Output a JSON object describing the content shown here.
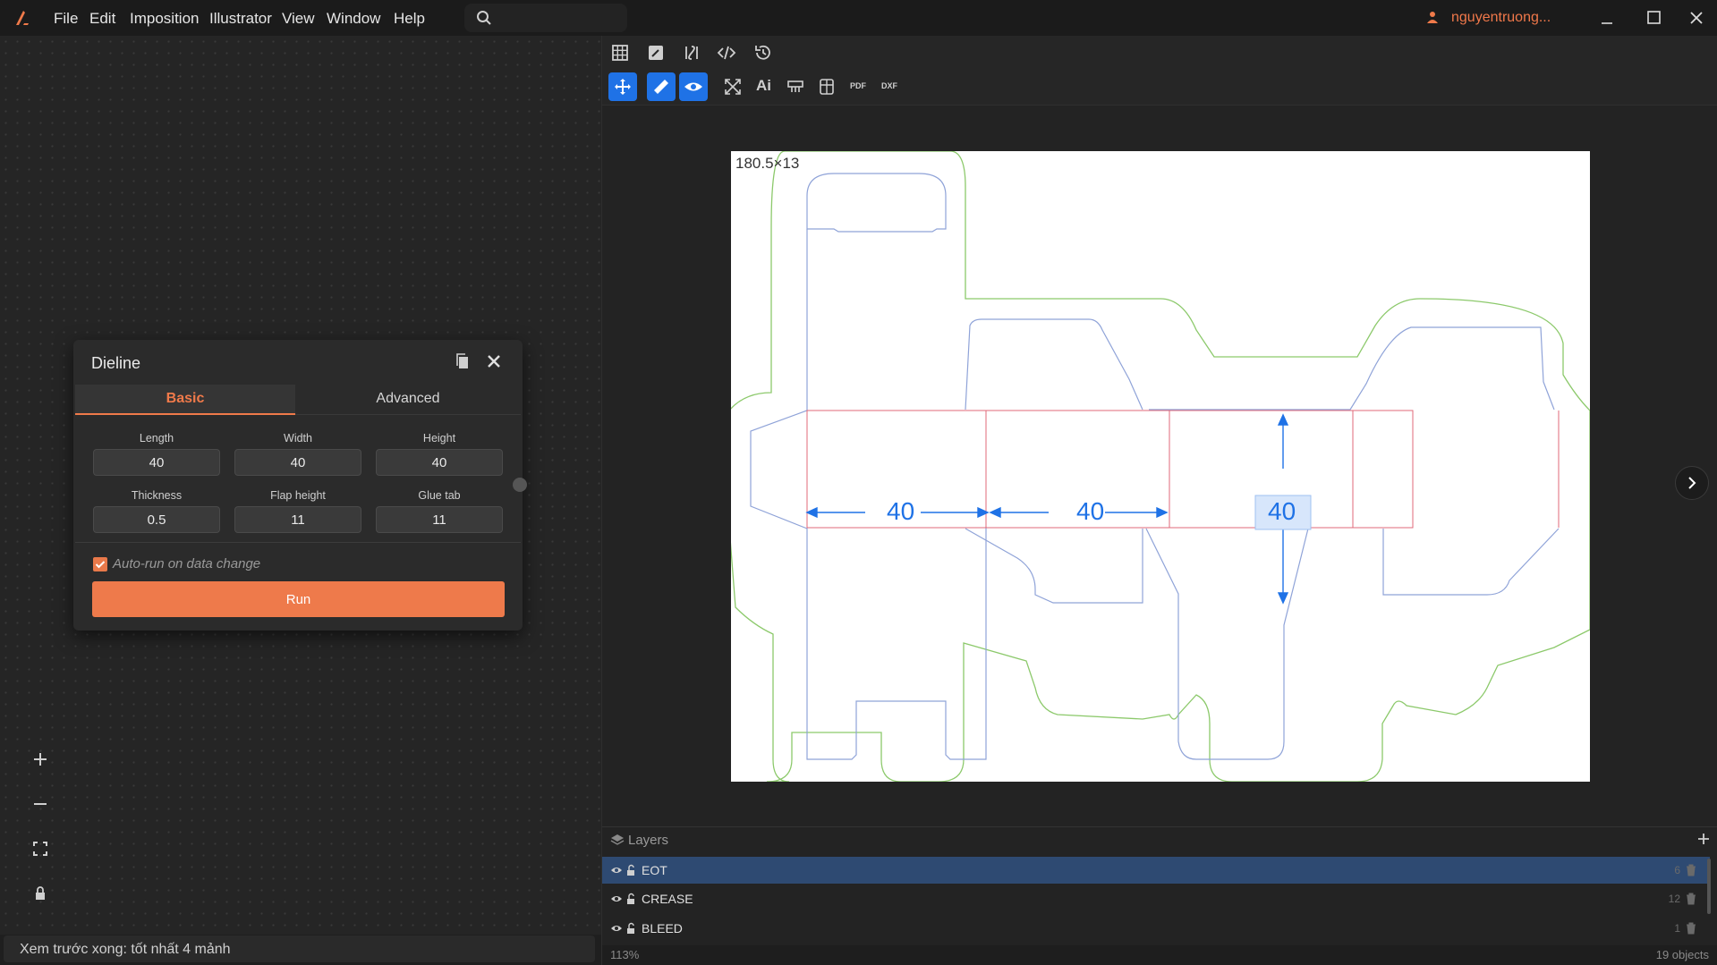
{
  "menu": [
    "File",
    "Edit",
    "Imposition",
    "Illustrator",
    "View",
    "Window",
    "Help"
  ],
  "user": {
    "name": "nguyentruong..."
  },
  "status_text": "Xem trước xong: tốt nhất 4 mảnh",
  "dialog": {
    "title": "Dieline",
    "tabs": [
      "Basic",
      "Advanced"
    ],
    "fields": [
      {
        "label": "Length",
        "value": "40"
      },
      {
        "label": "Width",
        "value": "40"
      },
      {
        "label": "Height",
        "value": "40"
      },
      {
        "label": "Thickness",
        "value": "0.5"
      },
      {
        "label": "Flap height",
        "value": "11"
      },
      {
        "label": "Glue tab",
        "value": "11"
      }
    ],
    "auto_run_label": "Auto-run on data change",
    "auto_run_checked": true,
    "run_label": "Run"
  },
  "toolbar": {
    "row2_text_icons": [
      "Ai",
      "PDF",
      "DXF"
    ]
  },
  "canvas": {
    "dimension_label": "180.5×13",
    "measures": [
      "40",
      "40",
      "40"
    ]
  },
  "layers": {
    "title": "Layers",
    "rows": [
      {
        "name": "EOT",
        "count": "6"
      },
      {
        "name": "CREASE",
        "count": "12"
      },
      {
        "name": "BLEED",
        "count": "1"
      }
    ]
  },
  "footer": {
    "zoom": "113%",
    "objects": "19 objects"
  },
  "colors": {
    "accent": "#f07a4a",
    "blue": "#1f72e6",
    "cut": "#8fa3d8",
    "crease": "#e06a7a",
    "bleed": "#8cc96b"
  }
}
